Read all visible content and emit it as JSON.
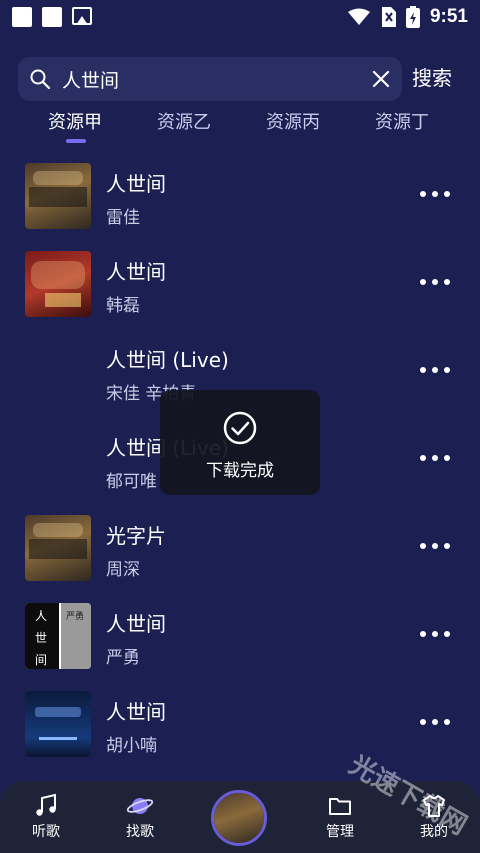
{
  "status_bar": {
    "time": "9:51",
    "left_icons": [
      "notification-square-icon",
      "notification-square-icon",
      "image-icon"
    ],
    "right_icons": [
      "wifi-icon",
      "no-sim-icon",
      "battery-icon"
    ]
  },
  "search": {
    "query": "人世间",
    "submit_label": "搜索"
  },
  "tabs": [
    {
      "label": "资源甲",
      "active": true
    },
    {
      "label": "资源乙",
      "active": false
    },
    {
      "label": "资源丙",
      "active": false
    },
    {
      "label": "资源丁",
      "active": false
    }
  ],
  "songs": [
    {
      "title": "人世间",
      "artist": "雷佳"
    },
    {
      "title": "人世间",
      "artist": "韩磊"
    },
    {
      "title": "人世间 (Live)",
      "artist": "宋佳 辛柏青"
    },
    {
      "title": "人世间 (Live)",
      "artist": "郁可唯"
    },
    {
      "title": "光字片",
      "artist": "周深"
    },
    {
      "title": "人世间",
      "artist": "严勇"
    },
    {
      "title": "人世间",
      "artist": "胡小喃"
    }
  ],
  "cover_c_text": [
    "人",
    "世",
    "间",
    "严勇"
  ],
  "toast": {
    "message": "下载完成",
    "icon": "check-circle-icon"
  },
  "bottom_nav": {
    "items": [
      {
        "label": "听歌",
        "icon": "music-note-icon"
      },
      {
        "label": "找歌",
        "icon": "planet-icon"
      },
      {
        "label": "管理",
        "icon": "folder-icon"
      },
      {
        "label": "我的",
        "icon": "shirt-icon"
      }
    ]
  },
  "watermark": "光速下载网",
  "colors": {
    "background": "#1b1f52",
    "search_bg": "#2a2f63",
    "accent": "#7b6bf0",
    "nav_bg": "#1f2338"
  }
}
